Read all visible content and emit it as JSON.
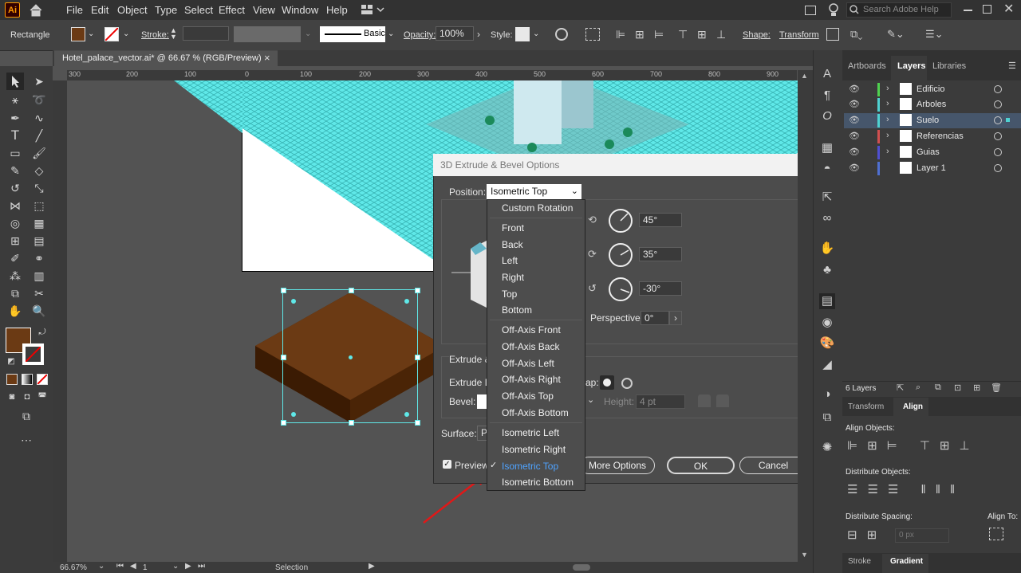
{
  "app": {
    "logo": "Ai"
  },
  "menu": [
    "File",
    "Edit",
    "Object",
    "Type",
    "Select",
    "Effect",
    "View",
    "Window",
    "Help"
  ],
  "search": {
    "placeholder": "Search Adobe Help"
  },
  "control": {
    "tool_name": "Rectangle",
    "stroke_label": "Stroke:",
    "stroke_style": "Basic",
    "opacity_label": "Opacity:",
    "opacity_value": "100%",
    "style_label": "Style:",
    "shape_label": "Shape:",
    "transform_label": "Transform"
  },
  "document": {
    "tab_title": "Hotel_palace_vector.ai* @ 66.67 % (RGB/Preview)",
    "close": "×"
  },
  "ruler": {
    "h": [
      "300",
      "200",
      "100",
      "0",
      "100",
      "200",
      "300",
      "400",
      "500",
      "600",
      "700",
      "800",
      "900"
    ]
  },
  "panel": {
    "tabs": [
      "Artboards",
      "Layers",
      "Libraries"
    ],
    "layers": [
      {
        "name": "Edificio",
        "color": "#4fd14f"
      },
      {
        "name": "Arboles",
        "color": "#4fd1d1"
      },
      {
        "name": "Suelo",
        "color": "#4fd1d1"
      },
      {
        "name": "Referencias",
        "color": "#d14f4f"
      },
      {
        "name": "Guias",
        "color": "#4f4fd1"
      },
      {
        "name": "Layer 1",
        "color": "#4f6fd1"
      }
    ],
    "layer_count": "6 Layers",
    "lower_tabs": [
      "Transform",
      "Align"
    ],
    "align_objects": "Align Objects:",
    "distribute_objects": "Distribute Objects:",
    "distribute_spacing": "Distribute Spacing:",
    "align_to": "Align To:",
    "spacing_value": "0 px",
    "bottom_tabs": [
      "Stroke",
      "Gradient"
    ]
  },
  "dialog": {
    "title": "3D Extrude & Bevel Options",
    "position_label": "Position:",
    "position_value": "Isometric Top",
    "rot_x": "45°",
    "rot_y": "35°",
    "rot_z": "-30°",
    "perspective_label": "Perspective:",
    "perspective_value": "0°",
    "extrude_label": "Extrude &",
    "extrude_depth_label": "Extrude D",
    "cap_label": "ap:",
    "bevel_label": "Bevel:",
    "height_label": "Height:",
    "height_value": "4 pt",
    "surface_label": "Surface:",
    "surface_value": "P",
    "preview_label": "Preview",
    "more_options": "More Options",
    "ok": "OK",
    "cancel": "Cancel"
  },
  "dropdown": {
    "items": [
      "Custom Rotation",
      "Front",
      "Back",
      "Left",
      "Right",
      "Top",
      "Bottom",
      "Off-Axis Front",
      "Off-Axis Back",
      "Off-Axis Left",
      "Off-Axis Right",
      "Off-Axis Top",
      "Off-Axis Bottom",
      "Isometric Left",
      "Isometric Right",
      "Isometric Top",
      "Isometric Bottom"
    ],
    "selected": "Isometric Top"
  },
  "status": {
    "zoom": "66.67%",
    "page": "1",
    "tool": "Selection"
  },
  "colors": {
    "fill": "#6b3a14",
    "accent": "#4fa3ff",
    "grid": "#5fe8e8"
  }
}
